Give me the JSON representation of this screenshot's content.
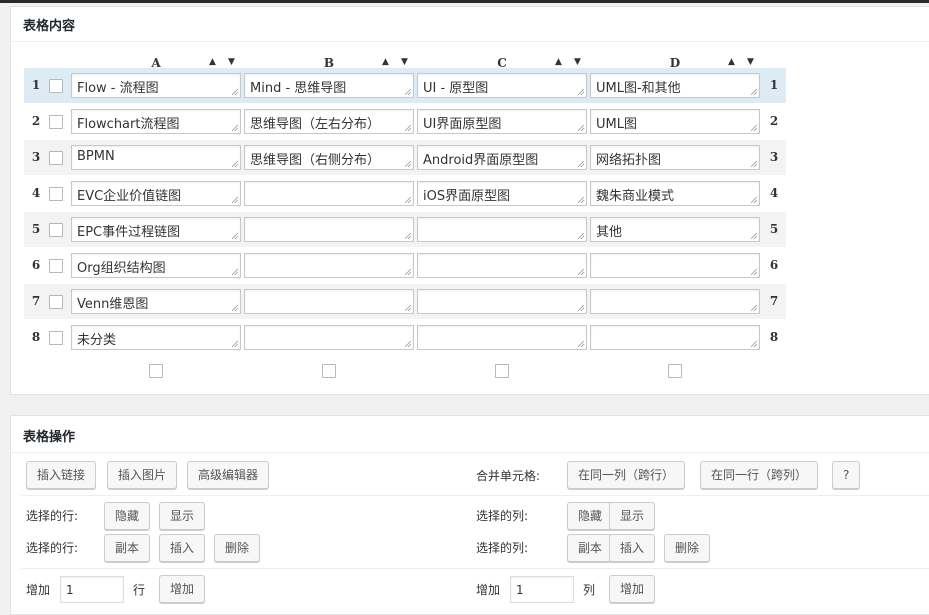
{
  "table_content": {
    "title": "表格内容",
    "columns": [
      "A",
      "B",
      "C",
      "D"
    ],
    "sort_up": "▲",
    "sort_down": "▼",
    "rows": [
      {
        "num": "1",
        "cells": [
          "Flow - 流程图",
          "Mind - 思维导图",
          "UI - 原型图",
          "UML图-和其他"
        ]
      },
      {
        "num": "2",
        "cells": [
          "Flowchart流程图",
          "思维导图（左右分布）",
          "UI界面原型图",
          "UML图"
        ]
      },
      {
        "num": "3",
        "cells": [
          "BPMN",
          "思维导图（右侧分布）",
          "Android界面原型图",
          "网络拓扑图"
        ]
      },
      {
        "num": "4",
        "cells": [
          "EVC企业价值链图",
          "",
          "iOS界面原型图",
          "魏朱商业模式"
        ]
      },
      {
        "num": "5",
        "cells": [
          "EPC事件过程链图",
          "",
          "",
          "其他"
        ]
      },
      {
        "num": "6",
        "cells": [
          "Org组织结构图",
          "",
          "",
          ""
        ]
      },
      {
        "num": "7",
        "cells": [
          "Venn维恩图",
          "",
          "",
          ""
        ]
      },
      {
        "num": "8",
        "cells": [
          "未分类",
          "",
          "",
          ""
        ]
      }
    ]
  },
  "table_ops": {
    "title": "表格操作",
    "insert_link": "插入链接",
    "insert_image": "插入图片",
    "advanced_editor": "高级编辑器",
    "merge_label": "合并单元格:",
    "merge_same_col": "在同一列（跨行）",
    "merge_same_row": "在同一行（跨列）",
    "help": "?",
    "sel_rows_label": "选择的行:",
    "sel_cols_label": "选择的列:",
    "hide": "隐藏",
    "show": "显示",
    "copy": "副本",
    "insert": "插入",
    "delete": "删除",
    "add_label": "增加",
    "rows_unit": "行",
    "cols_unit": "列",
    "add_button": "增加",
    "add_rows_value": "1",
    "add_cols_value": "1"
  }
}
